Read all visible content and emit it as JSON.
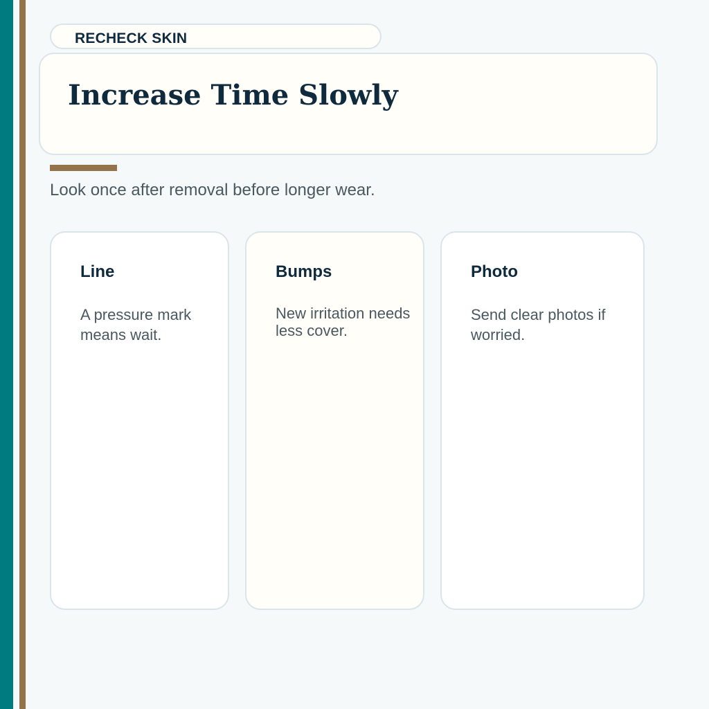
{
  "eyebrow": {
    "label": "RECHECK SKIN"
  },
  "header": {
    "title": "Increase Time Slowly"
  },
  "subtitle": "Look once after removal before longer wear.",
  "cards": [
    {
      "title": "Line",
      "body": "A pressure mark means wait."
    },
    {
      "title": "Bumps",
      "body": "New irritation needs less cover."
    },
    {
      "title": "Photo",
      "body": "Send clear photos if worried."
    }
  ],
  "colors": {
    "teal": "#007c7f",
    "brown": "#94734a",
    "ink": "#0f2a3d",
    "muted": "#4a5860",
    "page_bg": "#f6f9fa",
    "card_bg": "#fffef9",
    "card_border": "#d9e5e9"
  }
}
